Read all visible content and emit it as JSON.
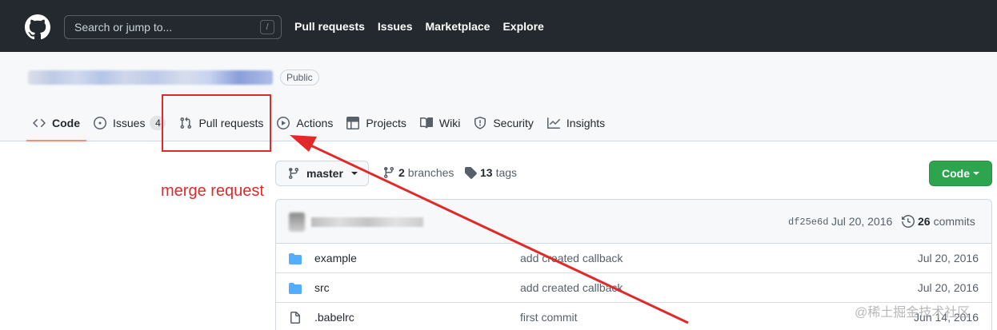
{
  "header": {
    "search_placeholder": "Search or jump to...",
    "search_shortcut": "/",
    "nav": [
      "Pull requests",
      "Issues",
      "Marketplace",
      "Explore"
    ]
  },
  "repo": {
    "visibility": "Public",
    "tabs": [
      {
        "label": "Code",
        "icon": "code-icon",
        "selected": true
      },
      {
        "label": "Issues",
        "icon": "issue-opened-icon",
        "count": "4"
      },
      {
        "label": "Pull requests",
        "icon": "git-pull-request-icon"
      },
      {
        "label": "Actions",
        "icon": "play-icon"
      },
      {
        "label": "Projects",
        "icon": "table-icon"
      },
      {
        "label": "Wiki",
        "icon": "book-icon"
      },
      {
        "label": "Security",
        "icon": "shield-icon"
      },
      {
        "label": "Insights",
        "icon": "graph-icon"
      }
    ]
  },
  "toolbar": {
    "branch": "master",
    "branches_count": "2",
    "branches_label": "branches",
    "tags_count": "13",
    "tags_label": "tags",
    "code_button": "Code"
  },
  "latest_commit": {
    "sha": "df25e6d",
    "date": "Jul 20, 2016",
    "commits_count": "26",
    "commits_label": "commits"
  },
  "files": [
    {
      "name": "example",
      "type": "folder",
      "message": "add created callback",
      "date": "Jul 20, 2016"
    },
    {
      "name": "src",
      "type": "folder",
      "message": "add created callback",
      "date": "Jul 20, 2016"
    },
    {
      "name": ".babelrc",
      "type": "file",
      "message": "first commit",
      "date": "Jun 14, 2016"
    }
  ],
  "annotation": {
    "label": "merge request",
    "color": "#e02a2a"
  },
  "watermark": "@稀土掘金技术社区",
  "colors": {
    "header_bg": "#24292f",
    "primary_button": "#2da44e",
    "folder_icon": "#54aeff",
    "selected_tab_underline": "#fd8c73"
  }
}
